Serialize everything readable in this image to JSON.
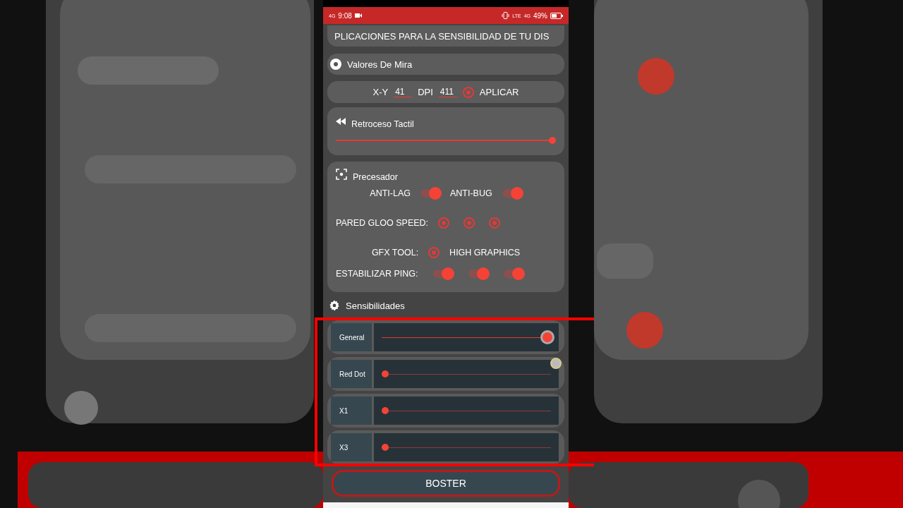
{
  "status_bar": {
    "network": "4G",
    "time": "9:08",
    "lte": "LTE",
    "data": "4G",
    "battery": "49%"
  },
  "banner": "PLICACIONES PARA LA SENSIBILIDAD DE TU DIS",
  "valores": {
    "title": "Valores De Mira"
  },
  "mira": {
    "xy_label": "X-Y",
    "xy_value": "41",
    "dpi_label": "DPI",
    "dpi_value": "411",
    "apply": {
      "label": "APLICAR",
      "selected": true
    }
  },
  "retroceso": {
    "title": "Retroceso Tactil",
    "level": 1.0
  },
  "precesador": {
    "title": "Precesador",
    "toggles": [
      {
        "label": "ANTI-LAG",
        "on": true
      },
      {
        "label": "ANTI-BUG",
        "on": true
      }
    ],
    "gloo": {
      "label": "PARED GLOO SPEED:",
      "options": [
        {
          "selected": true
        },
        {
          "selected": true
        },
        {
          "selected": true
        }
      ]
    },
    "gfx": {
      "label": "GFX TOOL:",
      "selected": true,
      "option": "HIGH GRAPHICS"
    },
    "ping": {
      "label": "ESTABILIZAR PING:",
      "toggles": [
        {
          "on": true
        },
        {
          "on": true
        },
        {
          "on": true
        }
      ]
    }
  },
  "sensibilidades": {
    "title": "Sensibilidades",
    "sliders": [
      {
        "label": "General",
        "level": 1.0
      },
      {
        "label": "Red Dot",
        "level": 0
      },
      {
        "label": "X1",
        "level": 0
      },
      {
        "label": "X3",
        "level": 0
      }
    ]
  },
  "boost_button": "BOSTER"
}
